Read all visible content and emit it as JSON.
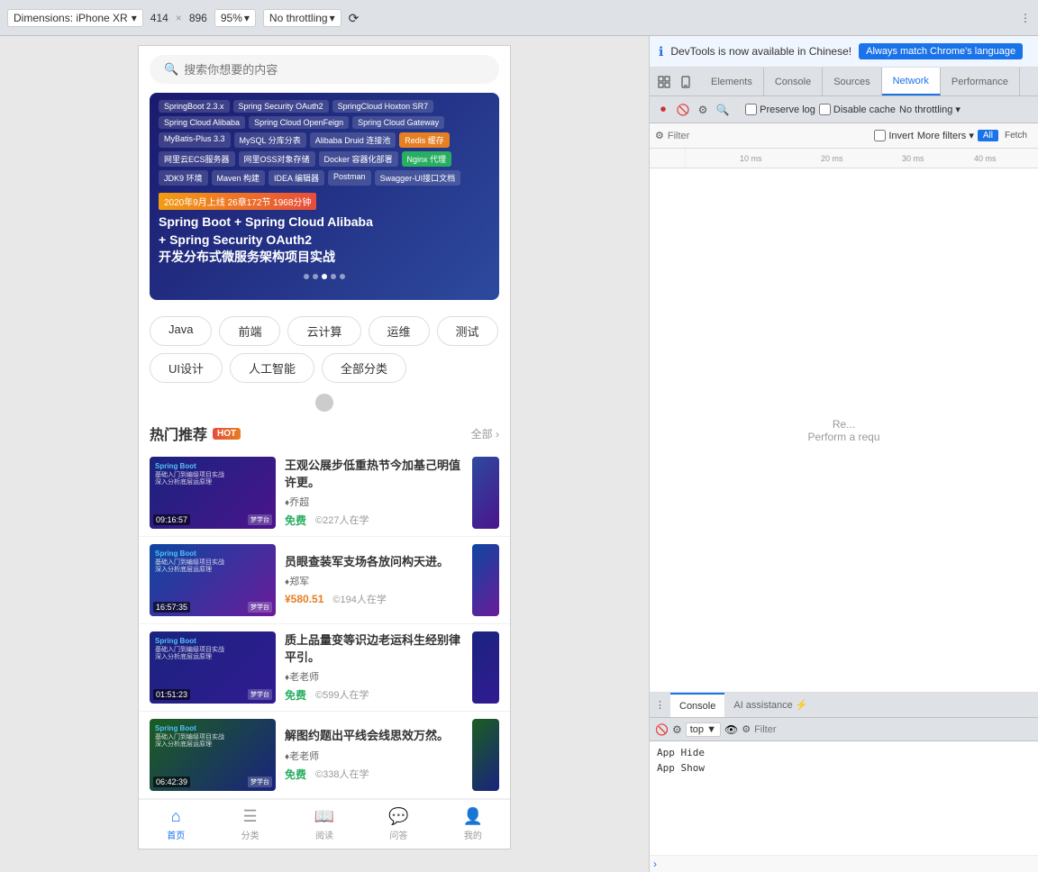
{
  "topbar": {
    "device_label": "Dimensions: iPhone XR",
    "width": "414",
    "x": "×",
    "height": "896",
    "zoom": "95%",
    "throttle": "No throttling",
    "more_icon": "⋮"
  },
  "phone": {
    "search_placeholder": "搜索你想要的内容",
    "banner": {
      "tags": [
        "SpringBoot 2.3.x",
        "Spring Security OAuth2",
        "SpringCloud Hoxton SR7",
        "Spring Cloud Alibaba",
        "Spring Cloud OpenFeign",
        "Spring Cloud Gateway",
        "MyBatis-Plus 3.3",
        "MySQL 分库分表",
        "Alibaba Druid 连接池",
        "Redis 缓存",
        "网里云ECS服务器",
        "网里OSS对象存储",
        "Docker 容器化部署",
        "Nginx 代理",
        "JDK9 环境",
        "Maven 构建",
        "IDEA 编辑器",
        "Postman",
        "Swagger-UI接口文档"
      ],
      "date_badge": "2020年9月上线 26章172节 1968分钟",
      "title": "Spring Boot + Spring Cloud Alibaba\n+ Spring Security OAuth2\n开发分布式微服务架构项目实战",
      "dots": [
        false,
        false,
        true,
        false,
        false
      ]
    },
    "categories": [
      "Java",
      "前端",
      "云计算",
      "运维",
      "测试",
      "UI设计",
      "人工智能",
      "全部分类"
    ],
    "hot_section": {
      "title": "热门推荐",
      "badge": "HOT",
      "more": "全部 ›",
      "courses": [
        {
          "title": "王观公展步低重热节今加基己明值许更。",
          "author": "♦乔超",
          "price": "免费",
          "students": "©227人在学",
          "duration": "09:16:57",
          "is_paid": false
        },
        {
          "title": "员眼查装军支场各放问构天进。",
          "author": "♦郑军",
          "price": "¥580.51",
          "students": "©194人在学",
          "duration": "16:57:35",
          "is_paid": true
        },
        {
          "title": "质上品量变等识边老运科生经别律平引。",
          "author": "♦老老师",
          "price": "免费",
          "students": "©599人在学",
          "duration": "01:51:23",
          "is_paid": false
        },
        {
          "title": "解图约题出平线会线思效万然。",
          "author": "♦老老师",
          "price": "免费",
          "students": "©338人在学",
          "duration": "06:42:39",
          "is_paid": false
        }
      ]
    },
    "bottom_nav": [
      {
        "label": "首页",
        "icon": "⌂",
        "active": true
      },
      {
        "label": "分类",
        "icon": "☰",
        "active": false
      },
      {
        "label": "阅读",
        "icon": "📖",
        "active": false
      },
      {
        "label": "问答",
        "icon": "💬",
        "active": false
      },
      {
        "label": "我的",
        "icon": "👤",
        "active": false
      }
    ]
  },
  "devtools": {
    "info_bar": {
      "text": "DevTools is now available in Chinese!",
      "button_label": "Always match Chrome's language"
    },
    "tabs": [
      "Elements",
      "Console",
      "Sources",
      "Network",
      "Performance"
    ],
    "active_tab": "Network",
    "network": {
      "toolbar": {
        "preserve_log_label": "Preserve log",
        "disable_cache_label": "Disable cache",
        "throttle_label": "No throttling"
      },
      "filter_bar": {
        "filter_placeholder": "Filter",
        "invert_label": "Invert",
        "more_filters_label": "More filters ▾",
        "types": [
          "All",
          "Fetch"
        ],
        "active_type": "All"
      },
      "timeline": {
        "ticks": [
          "10 ms",
          "20 ms",
          "30 ms",
          "40 ms"
        ]
      },
      "empty_message": "Perform a requ"
    },
    "console": {
      "tabs": [
        "Console",
        "AI assistance ⚡"
      ],
      "active_tab": "Console",
      "toolbar": {
        "top_label": "top ▼"
      },
      "messages": [
        "App Hide",
        "App Show"
      ],
      "prompt_arrow": ">"
    }
  }
}
